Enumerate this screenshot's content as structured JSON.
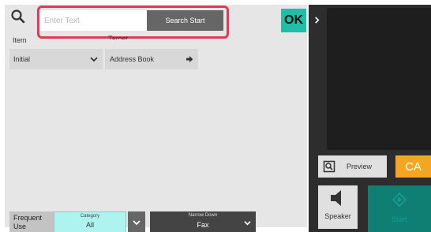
{
  "search": {
    "placeholder": "Enter Text",
    "start_label": "Search Start"
  },
  "ok_label": "OK",
  "labels": {
    "item": "Item",
    "target": "Target"
  },
  "item_select": {
    "value": "Initial"
  },
  "target_select": {
    "value": "Address Book"
  },
  "bottom_bar": {
    "frequent": [
      "Frequent",
      "Use"
    ],
    "category": {
      "caption": "Category",
      "value": "All"
    },
    "narrow_down": {
      "caption": "Narrow Down",
      "value": "Fax"
    }
  },
  "right_panel": {
    "preview_label": "Preview",
    "ca_label": "CA",
    "speaker_label": "Speaker",
    "start_label": "Start"
  },
  "colors": {
    "highlight": "#e03a57",
    "ok": "#1ebfa6",
    "ca": "#f4a623",
    "category": "#aef3f0",
    "start": "#0f7f74"
  },
  "icons": [
    "search-icon",
    "chevron-down-icon",
    "arrow-right-icon",
    "chevron-right-icon",
    "preview-icon",
    "speaker-icon",
    "start-icon"
  ]
}
